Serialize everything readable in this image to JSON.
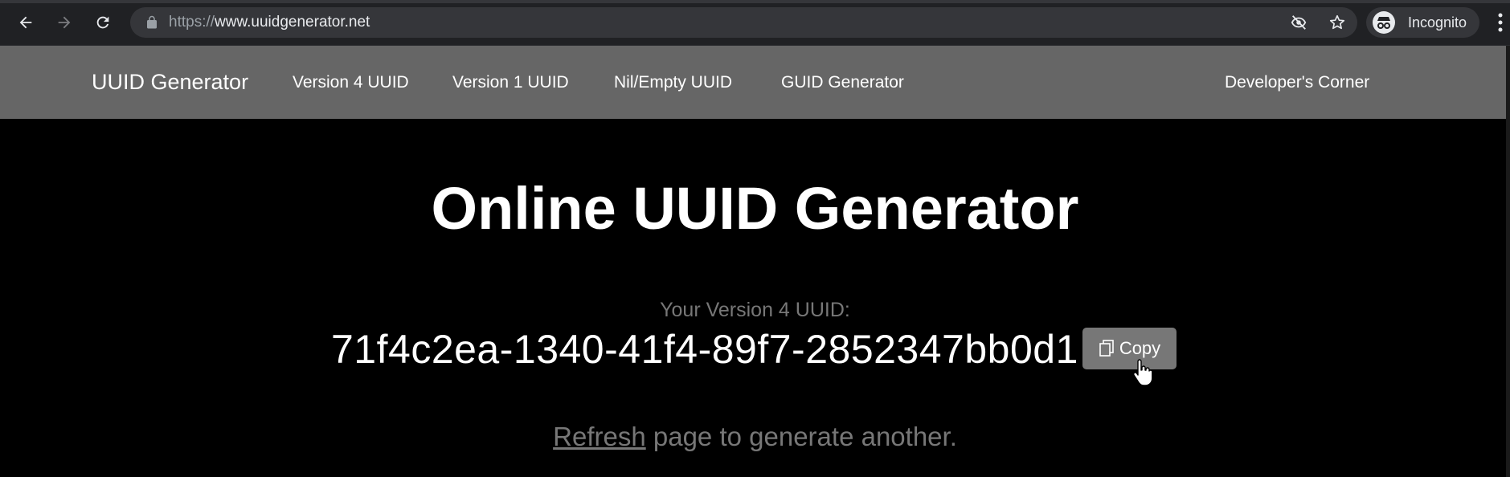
{
  "browser": {
    "url_scheme": "https://",
    "url_host": "www.uuidgenerator.net",
    "incognito_label": "Incognito"
  },
  "icons": {
    "back": "back-arrow-icon",
    "forward": "forward-arrow-icon",
    "reload": "reload-icon",
    "lock": "lock-icon",
    "tracking": "eye-slash-icon",
    "bookmark": "star-icon",
    "incognito": "incognito-icon",
    "menu": "vertical-dots-icon",
    "copy": "copy-icon"
  },
  "navbar": {
    "brand": "UUID Generator",
    "links": [
      "Version 4 UUID",
      "Version 1 UUID",
      "Nil/Empty UUID",
      "GUID Generator"
    ],
    "right_link": "Developer's Corner"
  },
  "main": {
    "title": "Online UUID Generator",
    "uuid_label": "Your Version 4 UUID:",
    "uuid_value": "71f4c2ea-1340-41f4-89f7-2852347bb0d1",
    "copy_label": "Copy",
    "refresh_link": "Refresh",
    "refresh_suffix": " page to generate another."
  },
  "colors": {
    "navbar_bg": "#666666",
    "page_bg": "#000000",
    "copy_button_bg": "#777777",
    "muted_text": "#777777"
  }
}
